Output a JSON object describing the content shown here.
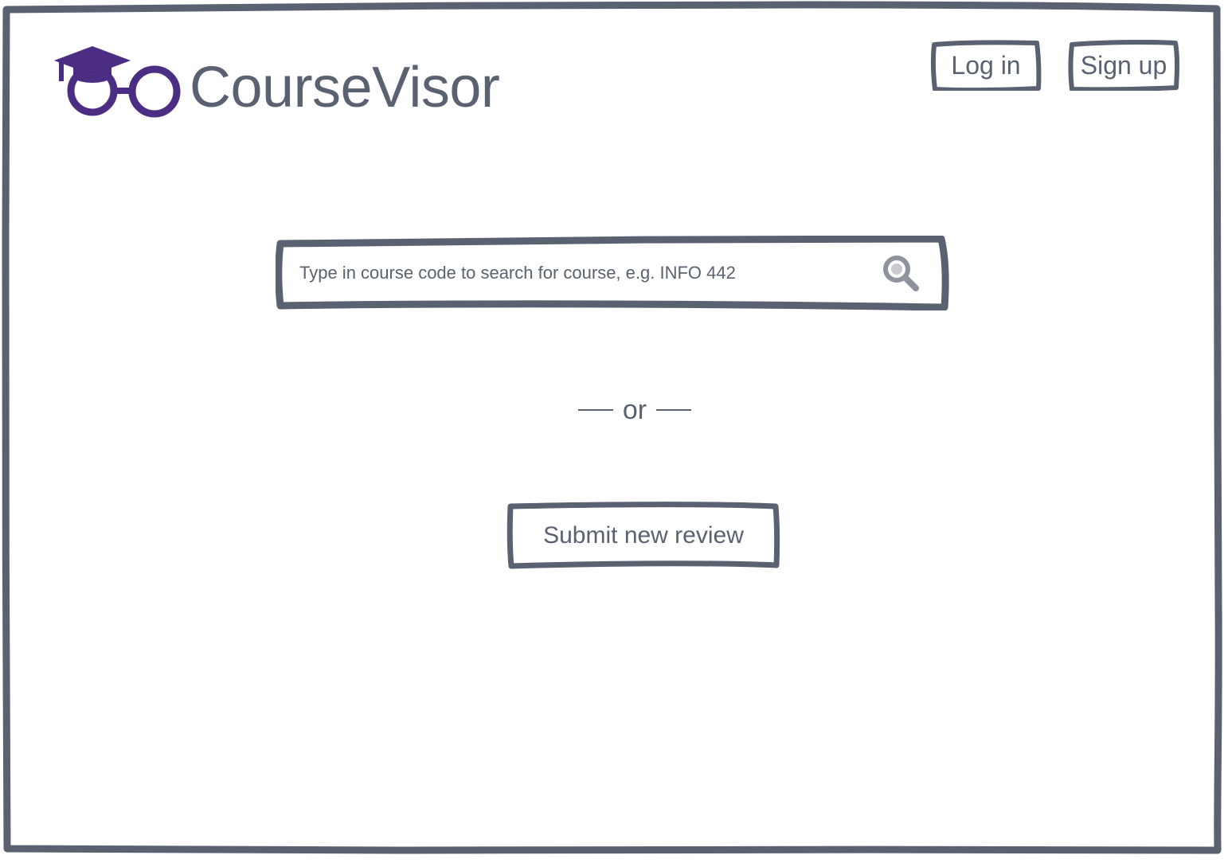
{
  "app": {
    "name": "CourseVisor"
  },
  "header": {
    "login_label": "Log in",
    "signup_label": "Sign up"
  },
  "search": {
    "placeholder": "Type in course code to search for course, e.g. INFO 442",
    "value": "",
    "icon": "search-icon"
  },
  "divider": {
    "text": "or"
  },
  "actions": {
    "submit_review_label": "Submit new review"
  },
  "colors": {
    "ink": "#5a6170",
    "brand": "#4b2e83",
    "search_icon": "#8e939c",
    "background": "#ffffff"
  }
}
